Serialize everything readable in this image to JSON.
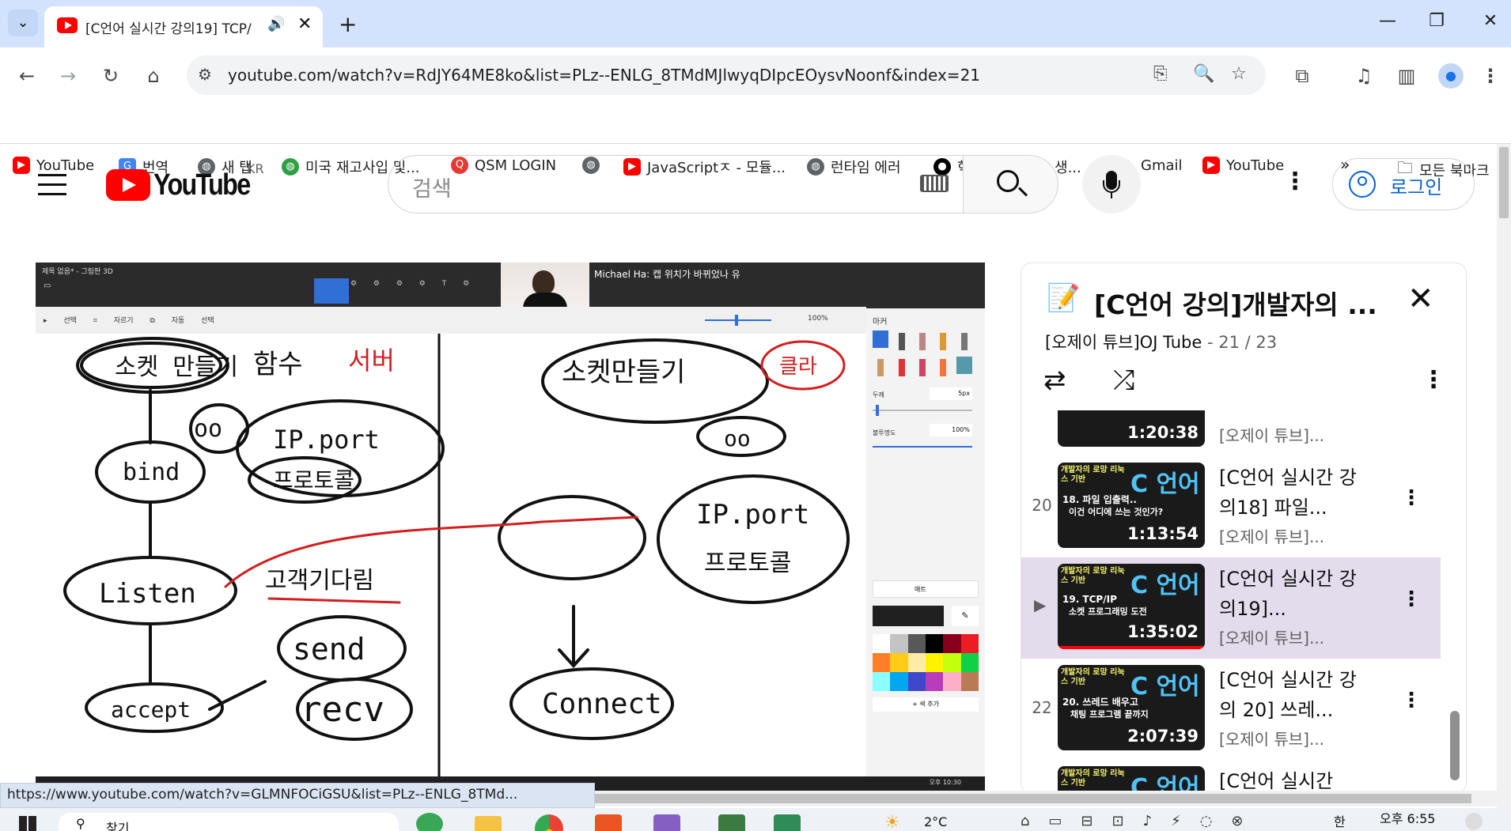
{
  "browser": {
    "tab_title": "[C언어 실시간 강의19] TCP/",
    "url": "youtube.com/watch?v=RdJY64ME8ko&list=PLz--ENLG_8TMdMJlwyqDIpcEOysvNoonf&index=21",
    "new_tab_symbol": "+",
    "bookmarks": [
      {
        "label": "YouTube",
        "icon": "youtube-icon"
      },
      {
        "label": "번역",
        "icon": "translate-icon"
      },
      {
        "label": "새 탭",
        "icon": "globe-icon"
      },
      {
        "label": "미국 재고사입 및...",
        "icon": "globe-icon"
      },
      {
        "label": "QSM LOGIN",
        "icon": "q-icon"
      },
      {
        "label": "",
        "icon": "globe-icon"
      },
      {
        "label": "JavaScriptㅈ - 모듈...",
        "icon": "youtube-icon"
      },
      {
        "label": "런타임 에러",
        "icon": "globe-icon"
      },
      {
        "label": "혁명적인 변화 - 생...",
        "icon": "circle-icon"
      },
      {
        "label": "Gmail",
        "icon": "google-icon"
      },
      {
        "label": "YouTube",
        "icon": "youtube-icon"
      }
    ],
    "all_bookmarks": "모든 북마크",
    "status_url": "https://www.youtube.com/watch?v=GLMNFOCiGSU&list=PLz--ENLG_8TMd..."
  },
  "youtube": {
    "logo_text": "YouTube",
    "region": "KR",
    "search_placeholder": "검색",
    "login_label": "로그인"
  },
  "video": {
    "paint_title": "제목 없음* - 그림판 3D",
    "chat_overlay": "Michael Ha: 캡 위치가 바뀌었나 유",
    "zoom": "100%",
    "panel_header": "마커",
    "thickness_label": "두께",
    "thickness_value": "5px",
    "opacity_label": "불투명도",
    "opacity_value": "100%",
    "matte_label": "매트",
    "add_color": "+ 색 추가",
    "clock": "오후 10:30"
  },
  "playlist": {
    "title": "[C언어 강의]개발자의 ...",
    "channel": "[오제이 튜브]OJ Tube",
    "position": "21 / 23",
    "items": [
      {
        "num": "",
        "title": "",
        "channel": "[오제이 튜브]...",
        "duration": "1:20:38"
      },
      {
        "num": "20",
        "title": "[C언어 실시간 강의18] 파일...",
        "channel": "[오제이 튜브]...",
        "duration": "1:13:54",
        "thumb_line1": "18. 파일 입출력..",
        "thumb_line2": "이건 어디에 쓰는 것인가?"
      },
      {
        "num": "",
        "title": "[C언어 실시간 강의19]...",
        "channel": "[오제이 튜브]...",
        "duration": "1:35:02",
        "thumb_line1": "19. TCP/IP",
        "thumb_line2": "소켓 프로그래밍 도전",
        "current": true
      },
      {
        "num": "22",
        "title": "[C언어 실시간 강의 20] 쓰레...",
        "channel": "[오제이 튜브]...",
        "duration": "2:07:39",
        "thumb_line1": "20. 쓰레드 배우고",
        "thumb_line2": "채팅 프로그램 끝까지"
      },
      {
        "num": "",
        "title": "[C언어 실시간",
        "channel": "",
        "duration": ""
      }
    ],
    "thumb_brand": "개발자의 로망 리눅스 기반",
    "thumb_c": "C 언어"
  },
  "taskbar": {
    "search_label": "찾기",
    "temperature": "2°C",
    "time": "오후 6:55",
    "ime": "한"
  }
}
